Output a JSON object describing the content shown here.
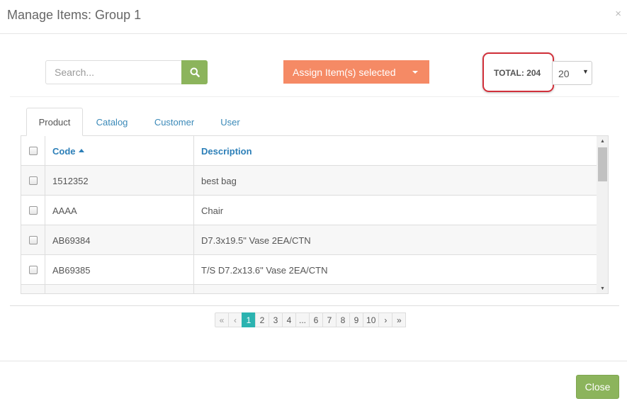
{
  "modal": {
    "title": "Manage Items: Group 1",
    "close_icon": "×"
  },
  "toolbar": {
    "search_placeholder": "Search...",
    "search_icon": "search-icon",
    "assign_label": "Assign Item(s) selected",
    "total_label": "TOTAL: 204",
    "page_size": "20"
  },
  "tabs": [
    {
      "label": "Product",
      "active": true
    },
    {
      "label": "Catalog",
      "active": false
    },
    {
      "label": "Customer",
      "active": false
    },
    {
      "label": "User",
      "active": false
    }
  ],
  "table": {
    "columns": {
      "code": "Code",
      "description": "Description"
    },
    "rows": [
      {
        "code": "1512352",
        "description": "best bag"
      },
      {
        "code": "AAAA",
        "description": "Chair"
      },
      {
        "code": "AB69384",
        "description": "D7.3x19.5\" Vase 2EA/CTN"
      },
      {
        "code": "AB69385",
        "description": "T/S D7.2x13.6\" Vase 2EA/CTN"
      },
      {
        "code": "",
        "description": ""
      }
    ]
  },
  "pagination": {
    "first": "«",
    "prev": "‹",
    "pages": [
      "1",
      "2",
      "3",
      "4",
      "...",
      "6",
      "7",
      "8",
      "9",
      "10"
    ],
    "active_page": "1",
    "next": "›",
    "last": "»"
  },
  "footer": {
    "close_label": "Close"
  },
  "colors": {
    "accent_green": "#8cb45c",
    "assign_orange": "#f58a65",
    "highlight_red": "#d1303a",
    "active_page": "#2bb3b0",
    "link_blue": "#2c7fb8"
  }
}
